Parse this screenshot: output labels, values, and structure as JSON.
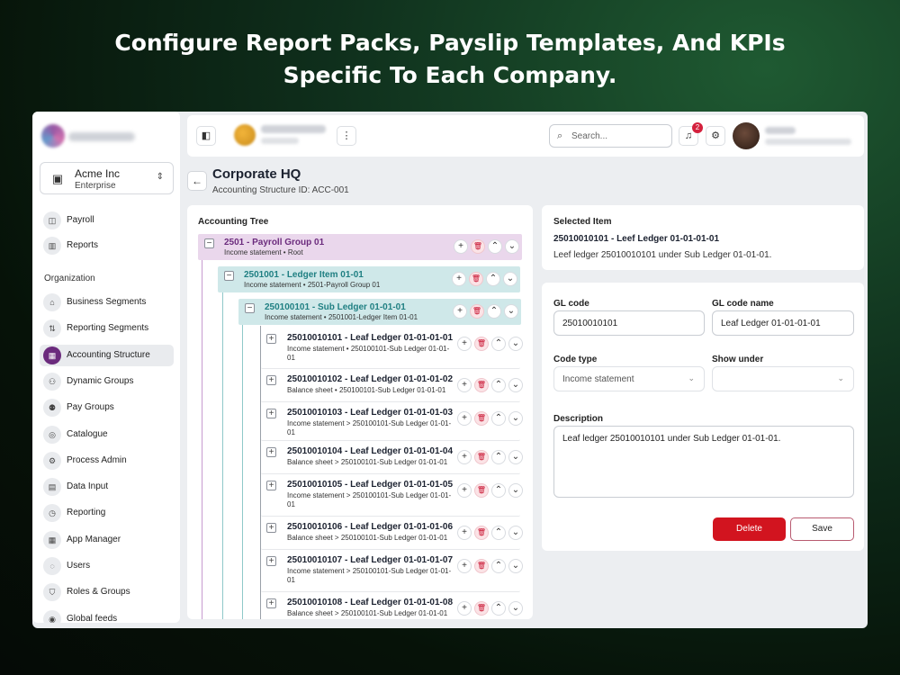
{
  "headline": {
    "line1": "Configure Report Packs, Payslip Templates, And KPIs",
    "line2": "Specific To Each Company."
  },
  "company": {
    "name": "Acme Inc",
    "plan": "Enterprise"
  },
  "sidebar": {
    "items_top": [
      {
        "label": "Payroll",
        "icon": "payroll-icon",
        "glyph": "◫"
      },
      {
        "label": "Reports",
        "icon": "bar-chart-icon",
        "glyph": "▥"
      }
    ],
    "section_label": "Organization",
    "items": [
      {
        "label": "Business Segments",
        "icon": "building-icon",
        "glyph": "⌂"
      },
      {
        "label": "Reporting Segments",
        "icon": "segments-icon",
        "glyph": "⇅"
      },
      {
        "label": "Accounting Structure",
        "icon": "grid-icon",
        "glyph": "▦",
        "active": true
      },
      {
        "label": "Dynamic Groups",
        "icon": "users-group-icon",
        "glyph": "⚇"
      },
      {
        "label": "Pay Groups",
        "icon": "user-pay-icon",
        "glyph": "⚉"
      },
      {
        "label": "Catalogue",
        "icon": "catalogue-icon",
        "glyph": "◎"
      },
      {
        "label": "Process Admin",
        "icon": "sliders-icon",
        "glyph": "⚙"
      },
      {
        "label": "Data Input",
        "icon": "document-icon",
        "glyph": "▤"
      },
      {
        "label": "Reporting",
        "icon": "reporting-icon",
        "glyph": "◷"
      },
      {
        "label": "App Manager",
        "icon": "apps-icon",
        "glyph": "▦"
      },
      {
        "label": "Users",
        "icon": "users-icon",
        "glyph": "◌"
      },
      {
        "label": "Roles & Groups",
        "icon": "shield-icon",
        "glyph": "⛉"
      },
      {
        "label": "Global feeds",
        "icon": "feed-icon",
        "glyph": "◉"
      }
    ]
  },
  "topbar": {
    "search_placeholder": "Search...",
    "notification_count": "2"
  },
  "page": {
    "title": "Corporate HQ",
    "subtitle": "Accounting Structure ID: ACC-001"
  },
  "tree": {
    "title": "Accounting Tree",
    "nodes": [
      {
        "level": 0,
        "title": "2501 - Payroll Group 01",
        "sub": "Income statement • Root"
      },
      {
        "level": 1,
        "title": "2501001 - Ledger Item 01-01",
        "sub": "Income statement • 2501-Payroll Group 01"
      },
      {
        "level": 2,
        "title": "250100101 - Sub Ledger 01-01-01",
        "sub": "Income statement • 2501001-Ledger Item 01-01"
      },
      {
        "level": 3,
        "title": "25010010101 - Leaf Ledger 01-01-01-01",
        "sub": "Income statement • 250100101-Sub Ledger 01-01-01"
      },
      {
        "level": 3,
        "title": "25010010102 - Leaf Ledger 01-01-01-02",
        "sub": "Balance sheet • 250100101-Sub Ledger 01-01-01"
      },
      {
        "level": 3,
        "title": "25010010103 - Leaf Ledger 01-01-01-03",
        "sub": "Income statement > 250100101-Sub Ledger 01-01-01"
      },
      {
        "level": 3,
        "title": "25010010104 - Leaf Ledger 01-01-01-04",
        "sub": "Balance sheet > 250100101-Sub Ledger 01-01-01"
      },
      {
        "level": 3,
        "title": "25010010105 - Leaf Ledger 01-01-01-05",
        "sub": "Income statement > 250100101-Sub Ledger 01-01-01"
      },
      {
        "level": 3,
        "title": "25010010106 - Leaf Ledger 01-01-01-06",
        "sub": "Balance sheet > 250100101-Sub Ledger 01-01-01"
      },
      {
        "level": 3,
        "title": "25010010107 - Leaf Ledger 01-01-01-07",
        "sub": "Income statement > 250100101-Sub Ledger 01-01-01"
      },
      {
        "level": 3,
        "title": "25010010108 - Leaf Ledger 01-01-01-08",
        "sub": "Balance sheet > 250100101-Sub Ledger 01-01-01"
      }
    ]
  },
  "selected": {
    "heading": "Selected Item",
    "title": "25010010101 - Leef Ledger 01-01-01-01",
    "description": "Leef ledger 25010010101 under Sub Ledger 01-01-01."
  },
  "form": {
    "gl_code_label": "GL code",
    "gl_code_value": "25010010101",
    "gl_name_label": "GL code name",
    "gl_name_value": "Leaf Ledger 01-01-01-01",
    "code_type_label": "Code type",
    "code_type_value": "Income statement",
    "show_under_label": "Show under",
    "show_under_value": "",
    "description_label": "Description",
    "description_value": "Leaf ledger 25010010101 under Sub Ledger 01-01-01.",
    "delete_label": "Delete",
    "save_label": "Save"
  }
}
